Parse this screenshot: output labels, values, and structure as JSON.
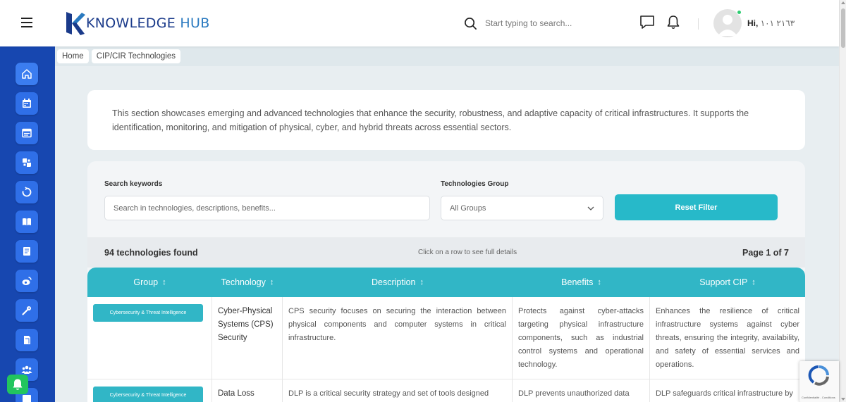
{
  "header": {
    "logo_text_a": "KNOWLEDGE",
    "logo_text_b": "HUB",
    "search_placeholder": "Start typing to search...",
    "greeting": "Hi,",
    "user_name": "٢١٦٣ ١٠١"
  },
  "breadcrumb": [
    "Home",
    "CIP/CIR Technologies"
  ],
  "intro": "This section showcases emerging and advanced technologies that enhance the security, robustness, and adaptive capacity of critical infrastructures. It supports the identification, monitoring, and mitigation of physical, cyber, and hybrid threats across essential sectors.",
  "filters": {
    "search_label": "Search keywords",
    "search_placeholder": "Search in technologies, descriptions, benefits...",
    "group_label": "Technologies Group",
    "group_value": "All Groups",
    "reset_label": "Reset Filter"
  },
  "results": {
    "found": "94 technologies found",
    "hint": "Click on a row to see full details",
    "page": "Page 1 of 7"
  },
  "table": {
    "columns": [
      "Group",
      "Technology",
      "Description",
      "Benefits",
      "Support CIP"
    ],
    "sort_glyph": "↕",
    "rows": [
      {
        "group": "Cybersecurity & Threat Intelligence",
        "technology": "Cyber-Physical Systems (CPS) Security",
        "description": "CPS security focuses on securing the interaction between physical components and computer systems in critical infrastructure.",
        "benefits": "Protects against cyber-attacks targeting physical infrastructure components, such as industrial control systems and operational technology.",
        "support": "Enhances the resilience of critical infrastructure systems against cyber threats, ensuring the integrity, availability, and safety of essential services and operations."
      },
      {
        "group": "Cybersecurity & Threat Intelligence",
        "technology": "Data Loss",
        "description": "DLP is a critical security strategy and set of tools designed",
        "benefits": "DLP prevents unauthorized data",
        "support": "DLP safeguards critical infrastructure by"
      }
    ]
  },
  "sidebar": {
    "icons": [
      "home-icon",
      "calendar-icon",
      "window-icon",
      "puzzle-icon",
      "cycle-icon",
      "book-icon",
      "document-icon",
      "weibo-icon",
      "key-icon",
      "tag-icon",
      "users-icon",
      "archive-icon"
    ]
  },
  "colors": {
    "sidebar": "#1747b0",
    "sidebar_button": "#2f6fe8",
    "accent": "#31b6c6",
    "notify_green": "#22c55e"
  },
  "recaptcha": "Confidentialité - Conditions"
}
